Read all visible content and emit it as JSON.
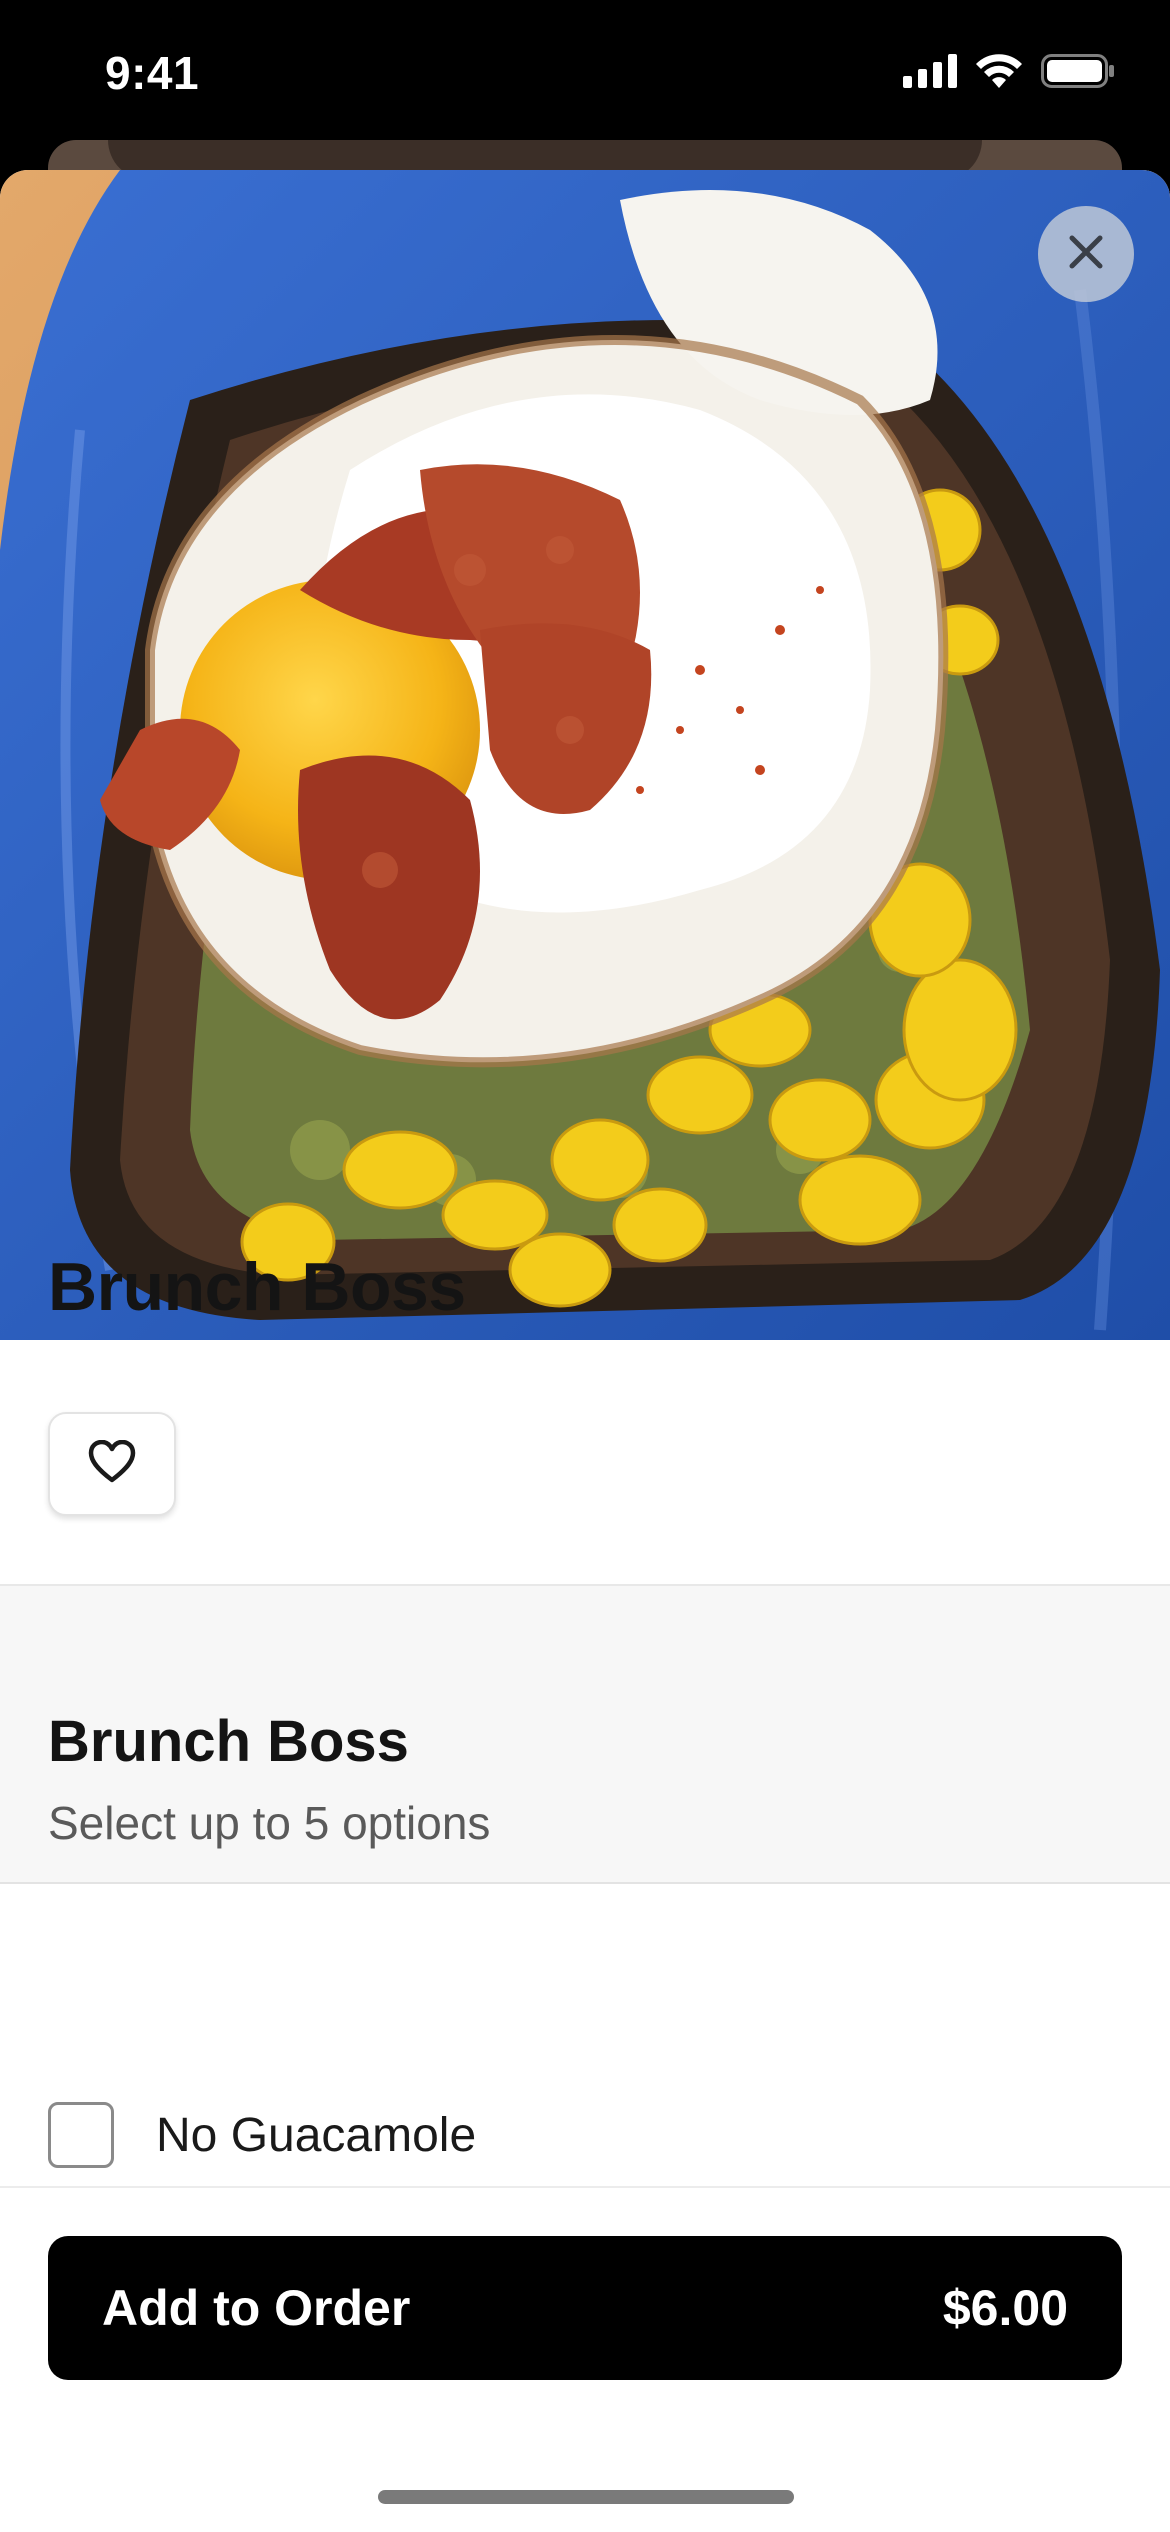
{
  "status_bar": {
    "time": "9:41",
    "icons": [
      "cellular-signal-icon",
      "wifi-icon",
      "battery-icon"
    ]
  },
  "modal": {
    "close_icon": "close-icon",
    "hero_image_alt": "Toast topped with avocado, fried egg, bacon and corn on a blue plate"
  },
  "item": {
    "title": "Brunch Boss",
    "favorite_icon": "heart-icon"
  },
  "options_group": {
    "title": "Brunch Boss",
    "subtitle": "Select up to 5 options",
    "options": [
      {
        "label": "No Guacamole",
        "checked": false
      }
    ]
  },
  "footer": {
    "button_label": "Add to Order",
    "price": "$6.00"
  },
  "colors": {
    "primary_button": "#000000",
    "plate_blue": "#2d5fc2",
    "section_bg": "#f7f7f7"
  }
}
